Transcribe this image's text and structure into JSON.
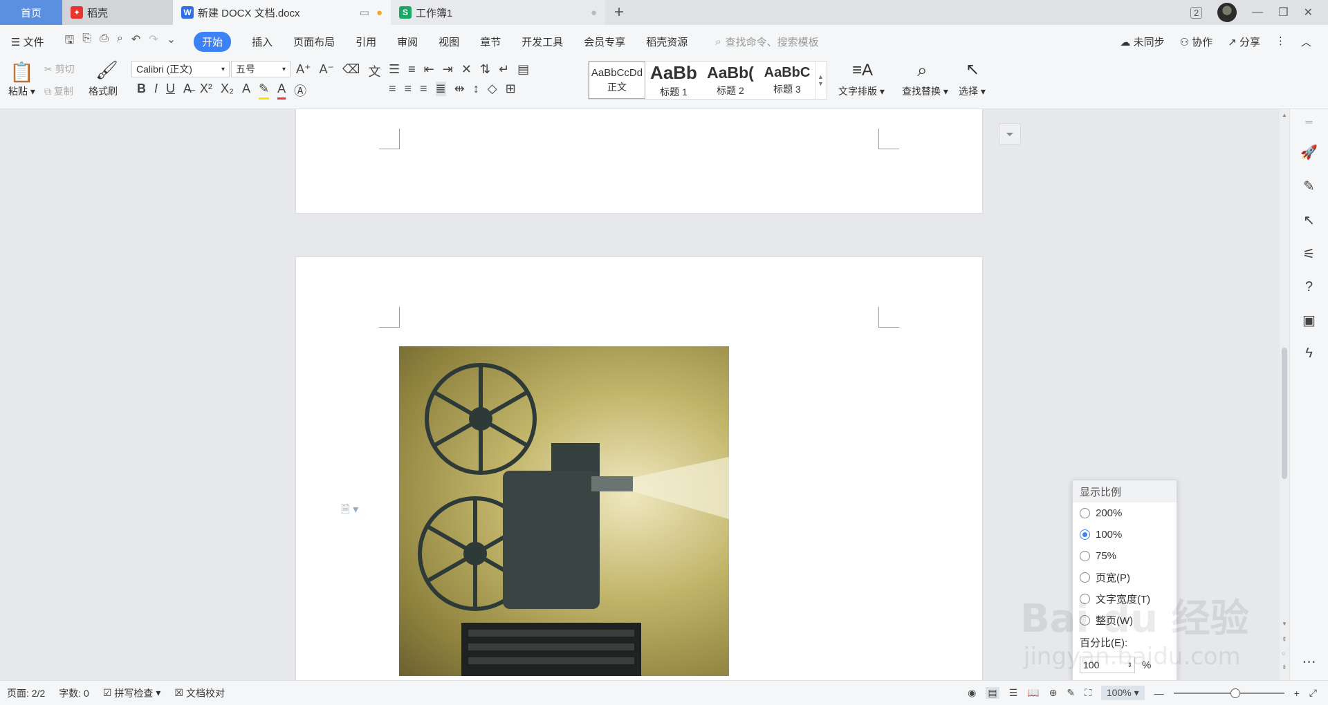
{
  "tabs": {
    "home": "首页",
    "wk": "稻壳",
    "doc": "新建 DOCX 文档.docx",
    "book": "工作簿1",
    "add": "+"
  },
  "window": {
    "badge": "2"
  },
  "menu": {
    "file": "文件",
    "items": [
      "开始",
      "插入",
      "页面布局",
      "引用",
      "审阅",
      "视图",
      "章节",
      "开发工具",
      "会员专享",
      "稻壳资源"
    ],
    "search": "查找命令、搜索模板",
    "unsynced": "未同步",
    "collab": "协作",
    "share": "分享"
  },
  "ribbon": {
    "paste": "粘贴",
    "cut": "剪切",
    "copy": "复制",
    "format_painter": "格式刷",
    "font_name": "Calibri (正文)",
    "font_size": "五号",
    "styles": [
      {
        "preview": "AaBbCcDd",
        "label": "正文"
      },
      {
        "preview": "AaBb",
        "label": "标题 1"
      },
      {
        "preview": "AaBb(",
        "label": "标题 2"
      },
      {
        "preview": "AaBbC",
        "label": "标题 3"
      }
    ],
    "text_layout": "文字排版",
    "find_replace": "查找替换",
    "select": "选择"
  },
  "zoom_popup": {
    "title": "显示比例",
    "options": [
      "200%",
      "100%",
      "75%",
      "页宽(P)",
      "文字宽度(T)",
      "整页(W)"
    ],
    "selected": "100%",
    "percent_label": "百分比(E):",
    "percent_value": "100",
    "percent_unit": "%"
  },
  "status": {
    "page": "页面: 2/2",
    "words": "字数: 0",
    "spell": "拼写检查",
    "proof": "文档校对",
    "zoom": "100%"
  },
  "watermark": {
    "main": "Bai du 经验",
    "url": "jingyan.baidu.com"
  },
  "colors": {
    "accent": "#3b82f6",
    "home_tab": "#5b8fe0"
  }
}
